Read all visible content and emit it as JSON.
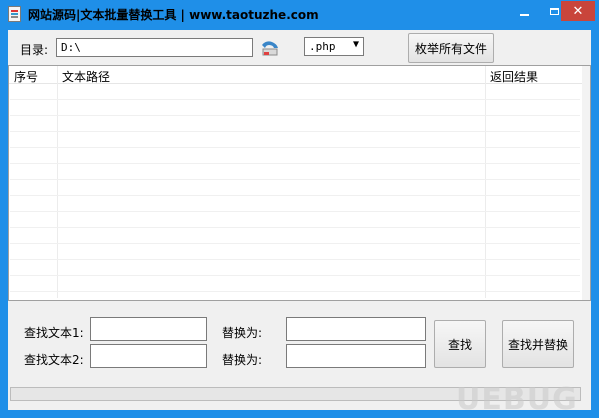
{
  "window": {
    "title": "网站源码|文本批量替换工具  | www.taotuzhe.com",
    "controls": {
      "minimize": "min",
      "maximize": "max",
      "close": "✕"
    }
  },
  "toolbar": {
    "dir_label": "目录:",
    "dir_value": "D:\\",
    "folder_icon": "folder-browse-icon",
    "ext_value": ".php",
    "enumerate_button": "枚举所有文件"
  },
  "list": {
    "columns": [
      "序号",
      "文本路径",
      "返回结果"
    ],
    "rows": []
  },
  "bottom": {
    "find1_label": "查找文本1:",
    "find1_value": "",
    "replace1_label": "替换为:",
    "replace1_value": "",
    "find2_label": "查找文本2:",
    "find2_value": "",
    "replace2_label": "替换为:",
    "replace2_value": "",
    "find_button": "查找",
    "find_replace_button": "查找并替换",
    "progress": 0
  },
  "watermark": "UEBUG"
}
